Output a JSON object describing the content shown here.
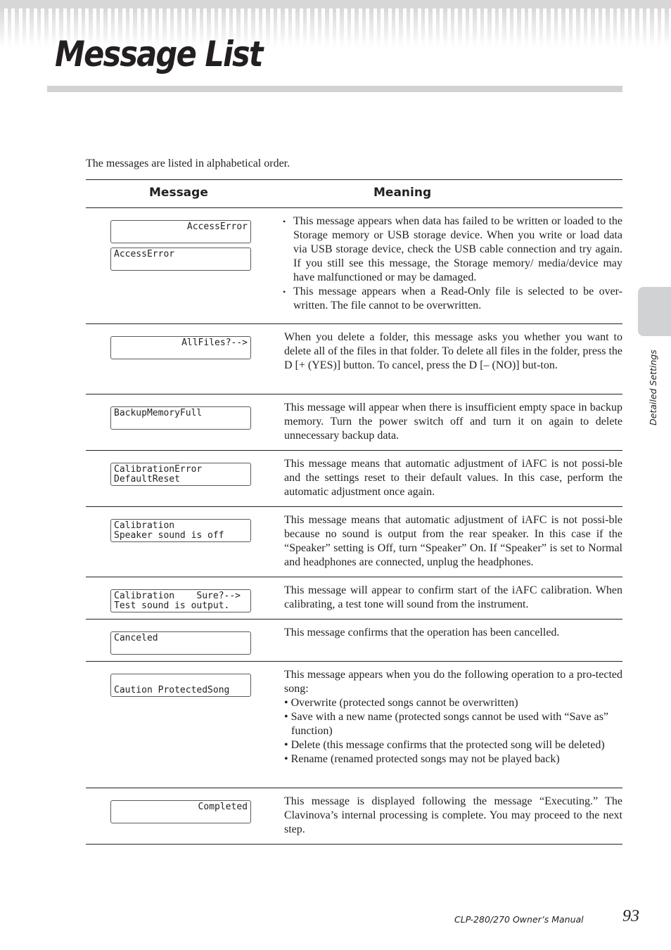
{
  "header": {
    "title": "Message List"
  },
  "intro": "The messages are listed in alphabetical order.",
  "table": {
    "columns": {
      "message": "Message",
      "meaning": "Meaning"
    },
    "rows": [
      {
        "lcd": [
          {
            "align": "right",
            "lines": [
              "AccessError",
              ""
            ]
          },
          {
            "align": "left",
            "lines": [
              "AccessError",
              ""
            ]
          }
        ],
        "bullets": [
          "This message appears when data has failed to be written or loaded to the Storage memory or USB storage device. When you write or load data via USB storage device, check the USB cable connection and try again. If you still see this message, the Storage memory/ media/device may have malfunctioned or may be damaged.",
          "This message appears when a Read-Only file is selected to be over-written. The file cannot to be overwritten."
        ]
      },
      {
        "lcd": [
          {
            "align": "right",
            "lines": [
              "AllFiles?-->",
              ""
            ]
          }
        ],
        "text": "When you delete a folder, this message asks you whether you want to delete all of the files in that folder. To delete all files in the folder, press the D [+ (YES)] button. To cancel, press the D [– (NO)] but-ton."
      },
      {
        "lcd": [
          {
            "align": "left",
            "lines": [
              "BackupMemoryFull",
              ""
            ]
          }
        ],
        "text": "This message will appear when there is insufficient empty space in backup memory. Turn the power switch off and turn it on again to delete unnecessary backup data."
      },
      {
        "lcd": [
          {
            "align": "left",
            "lines": [
              "CalibrationError",
              "DefaultReset"
            ]
          }
        ],
        "text": "This message means that automatic adjustment of iAFC is not possi-ble and the settings reset to their default values. In this case, perform the automatic adjustment once again."
      },
      {
        "lcd": [
          {
            "align": "left",
            "lines": [
              "Calibration",
              "Speaker sound is off"
            ]
          }
        ],
        "text": "This message means that automatic adjustment of iAFC is not possi-ble because no sound is output from the rear speaker. In this case if the “Speaker” setting is Off, turn “Speaker” On. If “Speaker” is set to Normal and headphones are connected, unplug the headphones."
      },
      {
        "lcd": [
          {
            "align": "left",
            "lines": [
              "Calibration    Sure?-->",
              "Test sound is output."
            ]
          }
        ],
        "text": "This message will appear to confirm start of the iAFC calibration. When calibrating, a test tone will sound from the instrument."
      },
      {
        "lcd": [
          {
            "align": "left",
            "lines": [
              "Canceled",
              ""
            ]
          }
        ],
        "text": "This message confirms that the operation has been cancelled."
      },
      {
        "lcd": [
          {
            "align": "left",
            "lines": [
              "",
              "Caution ProtectedSong"
            ]
          }
        ],
        "text": "This message appears when you do the following operation to a pro-tected song:",
        "list": [
          "• Overwrite (protected songs cannot be overwritten)",
          "• Save with a new name (protected songs cannot be used with “Save as” function)",
          "• Delete (this message confirms that the protected song will be deleted)",
          "• Rename (renamed protected songs may not be played back)"
        ]
      },
      {
        "lcd": [
          {
            "align": "right",
            "lines": [
              "Completed",
              ""
            ]
          }
        ],
        "text": "This message is displayed following the message “Executing.” The Clavinova’s internal processing is complete. You may proceed to the next step."
      }
    ]
  },
  "sidebar": {
    "section_label": "Detailed Settings"
  },
  "footer": {
    "manual": "CLP-280/270 Owner’s Manual",
    "page_number": "93"
  }
}
